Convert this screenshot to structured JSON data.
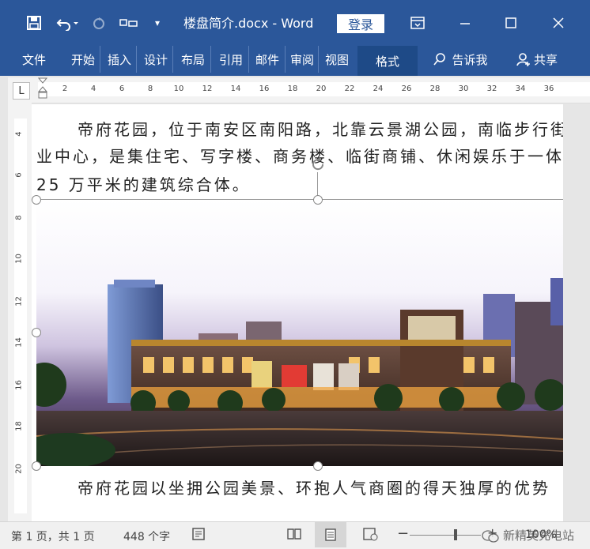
{
  "window": {
    "title": "楼盘简介.docx  -  Word",
    "login_label": "登录",
    "undo_icon": "undo-icon",
    "redo_icon": "redo-icon"
  },
  "ribbon": {
    "tabs": [
      "文件",
      "开始",
      "插入",
      "设计",
      "布局",
      "引用",
      "邮件",
      "审阅",
      "视图",
      "格式"
    ],
    "active_tab": "格式",
    "tell_me": "告诉我",
    "share": "共享"
  },
  "ruler": {
    "corner": "L",
    "h_ticks": [
      "2",
      "4",
      "6",
      "8",
      "10",
      "12",
      "14",
      "16",
      "18",
      "20",
      "22",
      "24",
      "26",
      "28",
      "30",
      "32",
      "34",
      "36"
    ],
    "v_ticks": [
      "4",
      "6",
      "8",
      "10",
      "12",
      "14",
      "16",
      "18",
      "20"
    ]
  },
  "document": {
    "para1_line1": "帝府花园，位于南安区南阳路，北靠云景湖公园，南临步行街",
    "para1_line2": "业中心，是集住宅、写字楼、商务楼、临街商铺、休闲娱乐于一体",
    "para1_line3": "25 万平米的建筑综合体。",
    "para2_line1": "帝府花园以坐拥公园美景、环抱人气商圈的得天独厚的优势"
  },
  "statusbar": {
    "page": "第 1 页，共 1 页",
    "words": "448 个字",
    "zoom": "100%",
    "watermark": "新精英充电站"
  },
  "colors": {
    "accent": "#2b579a",
    "accent_dark": "#1e4a87"
  }
}
